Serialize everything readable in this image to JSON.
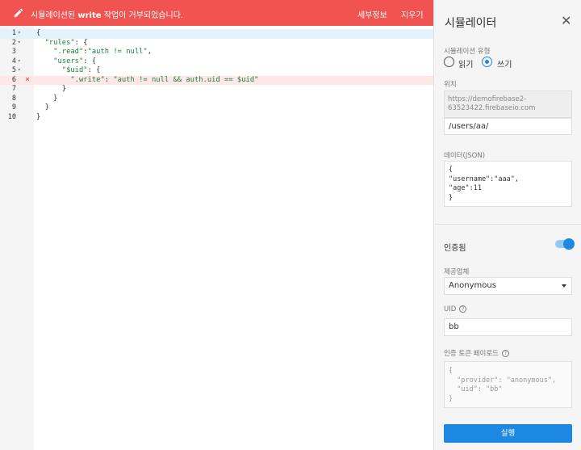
{
  "banner": {
    "message_prefix": "시뮬레이션된 ",
    "message_bold": "write",
    "message_suffix": " 작업이 거부되었습니다.",
    "details_label": "세부정보",
    "clear_label": "지우기",
    "color": "#f05350"
  },
  "editor": {
    "line_numbers": [
      "1",
      "2",
      "3",
      "4",
      "5",
      "6",
      "7",
      "8",
      "9",
      "10"
    ],
    "lines": [
      "{",
      "  \"rules\": {",
      "    \".read\":\"auth != null\",",
      "    \"users\": {",
      "      \"$uid\": {",
      "        \".write\": \"auth != null && auth.uid == $uid\"",
      "      }",
      "    }",
      "  }",
      "}"
    ],
    "error_marker": "×"
  },
  "panel": {
    "title": "시뮬레이터",
    "close_icon": "close-icon",
    "sim_type_label": "시뮬레이션 유형",
    "read_label": "읽기",
    "write_label": "쓰기",
    "selected_type": "쓰기",
    "location_label": "위치",
    "location_base": "https://demofirebase2-63523422.firebaseio.com",
    "location_path": "/users/aa/",
    "data_label": "데이터(JSON)",
    "data_json": "{\n\"username\":\"aaa\",\n\"age\":11\n}",
    "auth_label": "인증됨",
    "auth_enabled": true,
    "provider_label": "제공업체",
    "provider_value": "Anonymous",
    "uid_label": "UID",
    "uid_value": "bb",
    "token_label": "인증 토큰 페이로드",
    "token_payload": "{\n  \"provider\": \"anonymous\",\n  \"uid\": \"bb\"\n}",
    "run_label": "실행",
    "accent": "#1e88e5"
  }
}
